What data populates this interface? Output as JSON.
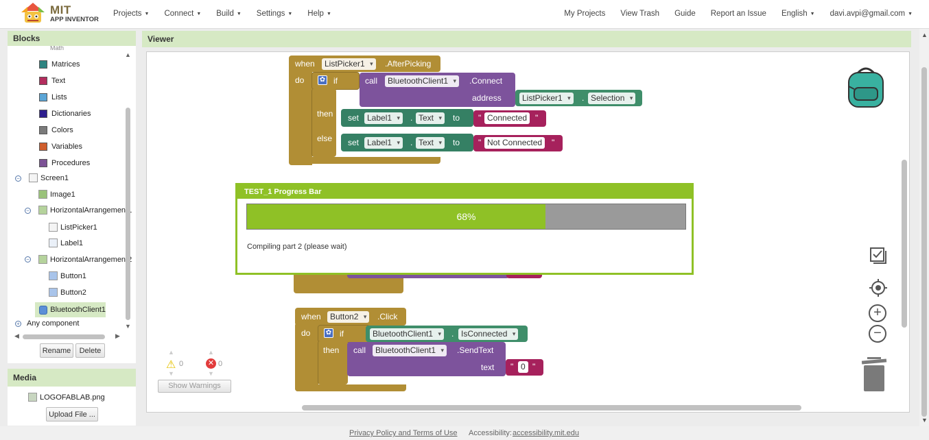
{
  "header": {
    "logo_line1": "MIT",
    "logo_line2": "APP INVENTOR",
    "menu_left": [
      "Projects",
      "Connect",
      "Build",
      "Settings",
      "Help"
    ],
    "my_projects": "My Projects",
    "view_trash": "View Trash",
    "guide": "Guide",
    "report_issue": "Report an Issue",
    "language": "English",
    "account": "davi.avpi@gmail.com"
  },
  "blocks_panel": {
    "title": "Blocks",
    "partial_top": "Math",
    "builtin": [
      {
        "label": "Matrices",
        "color": "#2f8481"
      },
      {
        "label": "Text",
        "color": "#b32d5e"
      },
      {
        "label": "Lists",
        "color": "#5ba5d6"
      },
      {
        "label": "Dictionaries",
        "color": "#2e1f8f"
      },
      {
        "label": "Colors",
        "color": "#7b7b7b"
      },
      {
        "label": "Variables",
        "color": "#d05f2d"
      },
      {
        "label": "Procedures",
        "color": "#7c5295"
      }
    ],
    "components": {
      "screen": "Screen1",
      "image": "Image1",
      "harr1": "HorizontalArrangement1",
      "listpicker": "ListPicker1",
      "label": "Label1",
      "harr2": "HorizontalArrangement2",
      "button1": "Button1",
      "button2": "Button2",
      "bluetooth": "BluetoothClient1",
      "any": "Any component"
    },
    "rename": "Rename",
    "delete": "Delete"
  },
  "media_panel": {
    "title": "Media",
    "file": "LOGOFABLAB.png",
    "upload": "Upload File ..."
  },
  "viewer": {
    "title": "Viewer",
    "block1": {
      "when": "when",
      "component": "ListPicker1",
      "event": ".AfterPicking",
      "do": "do",
      "if": "if",
      "then": "then",
      "else": "else",
      "call": "call",
      "bt": "BluetoothClient1",
      "connect": ".Connect",
      "address": "address",
      "lp": "ListPicker1",
      "dot": ".",
      "selection": "Selection",
      "set": "set",
      "label": "Label1",
      "text_prop": "Text",
      "to": "to",
      "connected": "Connected",
      "not_connected": "Not Connected"
    },
    "block2": {
      "when": "when",
      "component": "Button2",
      "event": ".Click",
      "do": "do",
      "if": "if",
      "then": "then",
      "bt": "BluetoothClient1",
      "dot": ".",
      "isconnected": "IsConnected",
      "call": "call",
      "sendtext": ".SendText",
      "text": "text",
      "value": "0"
    },
    "warnings_count": "0",
    "errors_count": "0",
    "show_warnings": "Show Warnings"
  },
  "progress_dialog": {
    "title": "TEST_1 Progress Bar",
    "percent_label": "68%",
    "progress": 0.68,
    "message": "Compiling part 2 (please wait)"
  },
  "footer": {
    "privacy": "Privacy Policy and Terms of Use",
    "accessibility_label": "Accessibility:",
    "accessibility_link": "accessibility.mit.edu"
  }
}
